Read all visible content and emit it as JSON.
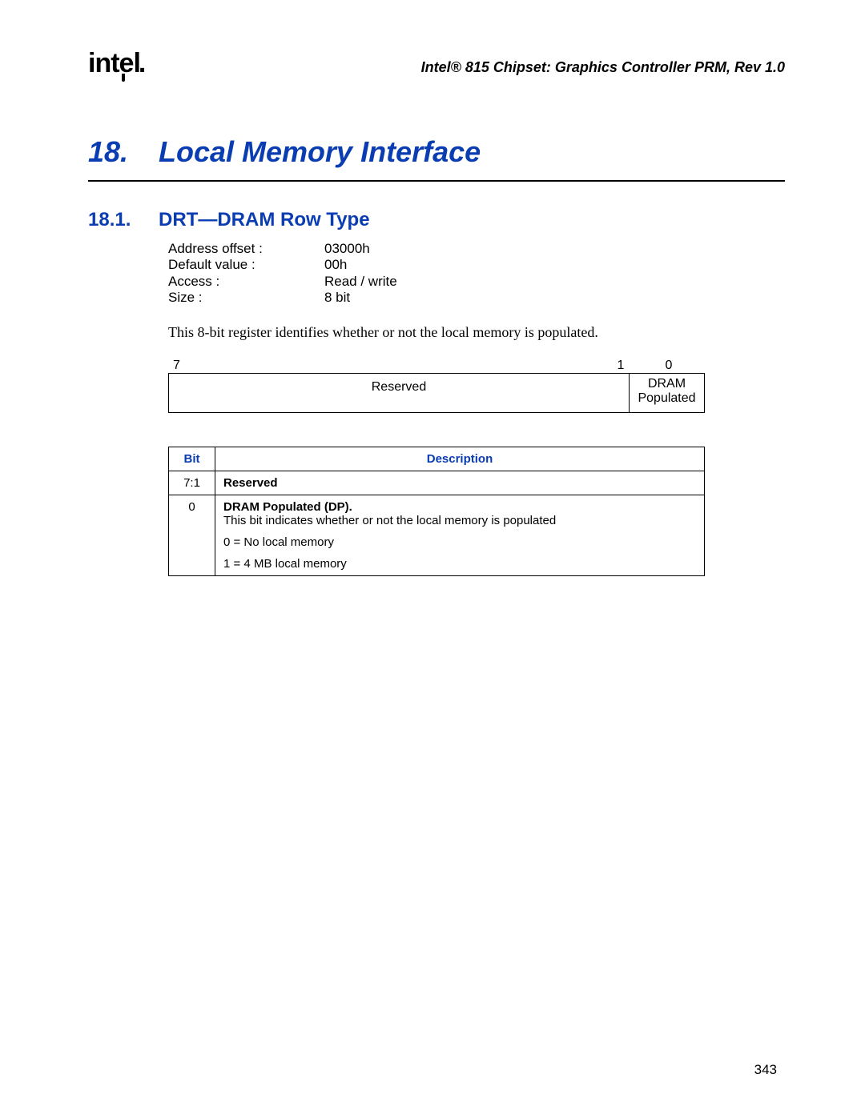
{
  "header": {
    "logo_text": "intel",
    "doc_title": "Intel® 815 Chipset: Graphics Controller PRM, Rev 1.0"
  },
  "chapter": {
    "number": "18.",
    "title": "Local Memory Interface"
  },
  "section": {
    "number": "18.1.",
    "title": "DRT—DRAM Row Type"
  },
  "properties": {
    "address_offset_label": "Address offset :",
    "address_offset_value": "03000h",
    "default_value_label": "Default value :",
    "default_value_value": "00h",
    "access_label": "Access :",
    "access_value": "Read / write",
    "size_label": "Size :",
    "size_value": "8 bit"
  },
  "description": "This 8-bit register identifies whether or not the local memory is populated.",
  "bitfield": {
    "num_left": "7",
    "num_1": "1",
    "num_0": "0",
    "reserved": "Reserved",
    "dram_line1": "DRAM",
    "dram_line2": "Populated"
  },
  "bit_table": {
    "header_bit": "Bit",
    "header_desc": "Description",
    "row0_bit": "7:1",
    "row0_desc": "Reserved",
    "row1_bit": "0",
    "row1_desc_bold": "DRAM Populated (DP).",
    "row1_desc_rest": " This bit indicates whether or not the local memory is populated",
    "row1_line2": "0 = No local memory",
    "row1_line3": "1 = 4 MB local memory"
  },
  "page_number": "343"
}
